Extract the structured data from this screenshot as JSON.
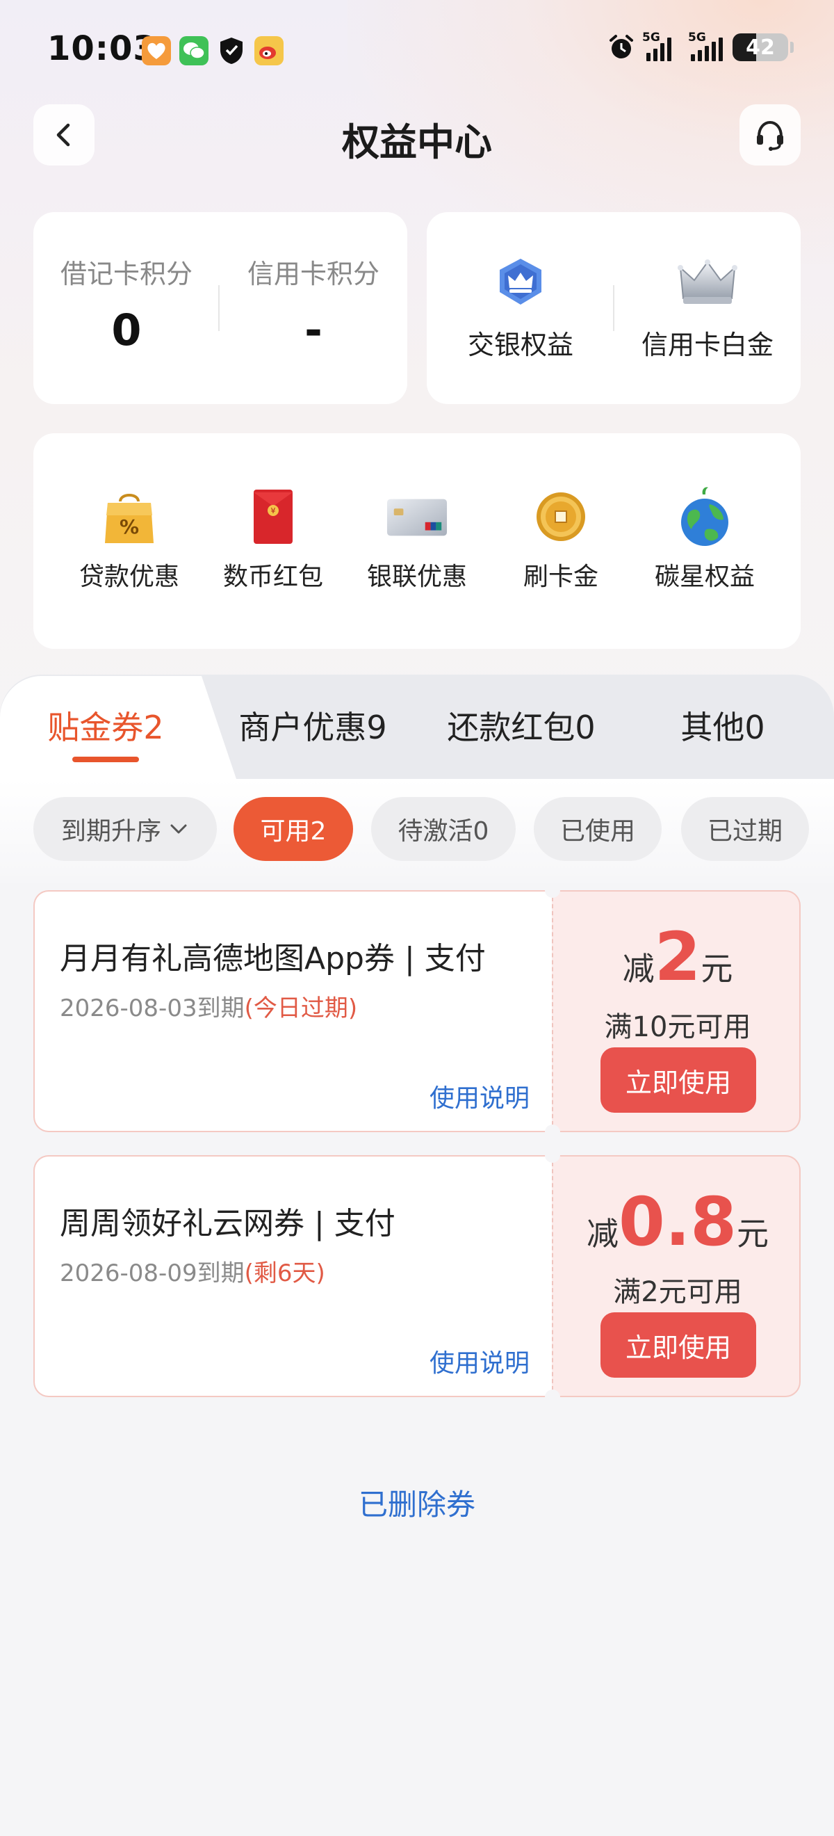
{
  "status_bar": {
    "time": "10:03",
    "network1": "5G",
    "network2": "5G",
    "battery": "42",
    "battery_level": 0.42
  },
  "header": {
    "title": "权益中心"
  },
  "points": {
    "debit_label": "借记卡积分",
    "debit_value": "0",
    "credit_label": "信用卡积分",
    "credit_value": "-"
  },
  "benefits": {
    "bocom_label": "交银权益",
    "platinum_label": "信用卡白金"
  },
  "grid": [
    {
      "label": "贷款优惠",
      "icon": "loan-bag-icon"
    },
    {
      "label": "数币红包",
      "icon": "red-envelope-icon"
    },
    {
      "label": "银联优惠",
      "icon": "unionpay-card-icon"
    },
    {
      "label": "刷卡金",
      "icon": "gold-coin-icon"
    },
    {
      "label": "碳星权益",
      "icon": "earth-icon"
    }
  ],
  "tabs": [
    {
      "label": "贴金券2",
      "active": true
    },
    {
      "label": "商户优惠9"
    },
    {
      "label": "还款红包0"
    },
    {
      "label": "其他0"
    }
  ],
  "filters": {
    "sort_label": "到期升序",
    "pills": [
      {
        "label": "可用2",
        "active": true
      },
      {
        "label": "待激活0"
      },
      {
        "label": "已使用"
      },
      {
        "label": "已过期"
      }
    ]
  },
  "coupons": [
    {
      "title": "月月有礼高德地图App券 | 支付",
      "date": "2026-08-03到期",
      "note": "(今日过期)",
      "howto": "使用说明",
      "prefix": "减",
      "amount": "2",
      "unit": "元",
      "condition": "满10元可用",
      "button": "立即使用"
    },
    {
      "title": "周周领好礼云网券 | 支付",
      "date": "2026-08-09到期",
      "note": "(剩6天)",
      "howto": "使用说明",
      "prefix": "减",
      "amount": "0.8",
      "unit": "元",
      "condition": "满2元可用",
      "button": "立即使用"
    }
  ],
  "footer": {
    "deleted_label": "已删除券"
  },
  "colors": {
    "accent": "#ec5a36",
    "coupon_red": "#e8524d",
    "link_blue": "#2f6fcf"
  }
}
